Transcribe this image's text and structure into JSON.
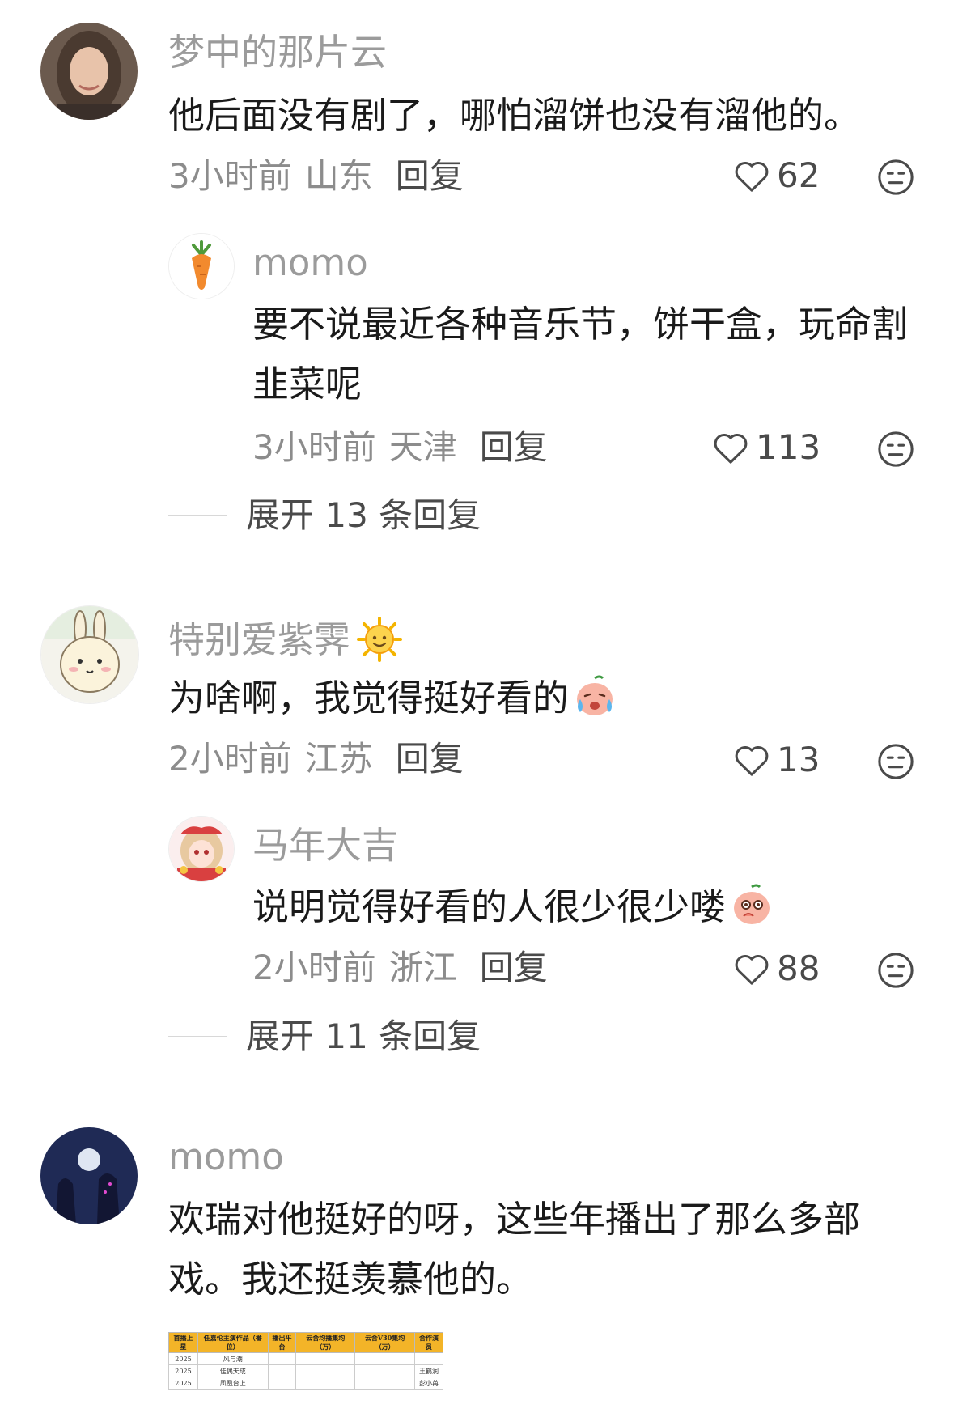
{
  "comments": [
    {
      "username": "梦中的那片云",
      "text": "他后面没有剧了，哪怕溜饼也没有溜他的。",
      "time": "3小时前",
      "location": "山东",
      "reply_label": "回复",
      "likes": "62",
      "replies": [
        {
          "username": "momo",
          "text": "要不说最近各种音乐节，饼干盒，玩命割韭菜呢",
          "time": "3小时前",
          "location": "天津",
          "reply_label": "回复",
          "likes": "113"
        }
      ],
      "expand_label": "展开 13 条回复"
    },
    {
      "username": "特别爱紫霁",
      "username_emoji": "sun-face-emoji",
      "text": "为啥啊，我觉得挺好看的",
      "text_emoji": "crying-peach-emoji",
      "time": "2小时前",
      "location": "江苏",
      "reply_label": "回复",
      "likes": "13",
      "replies": [
        {
          "username": "马年大吉",
          "text": "说明觉得好看的人很少很少喽",
          "text_emoji": "shy-peach-emoji",
          "time": "2小时前",
          "location": "浙江",
          "reply_label": "回复",
          "likes": "88"
        }
      ],
      "expand_label": "展开 11 条回复"
    },
    {
      "username": "momo",
      "text": "欢瑞对他挺好的呀，这些年播出了那么多部戏。我还挺羡慕他的。",
      "attachment_table": {
        "headers": [
          "首播上星",
          "任嘉伦主演作品（番位）",
          "播出平台",
          "云合均播集均（万）",
          "云合V30集均（万）",
          "合作演员"
        ],
        "rows": [
          [
            "2025",
            "风与潮",
            "",
            "",
            "",
            ""
          ],
          [
            "2025",
            "佳偶天成",
            "",
            "",
            "",
            "王鹤润"
          ],
          [
            "2025",
            "凤凰台上",
            "",
            "",
            "",
            "彭小苒"
          ]
        ]
      }
    }
  ],
  "colors": {
    "username": "#9b9b9b",
    "body_text": "#1a1a1a",
    "meta": "#8c8c8c",
    "table_header": "#f3b428"
  }
}
